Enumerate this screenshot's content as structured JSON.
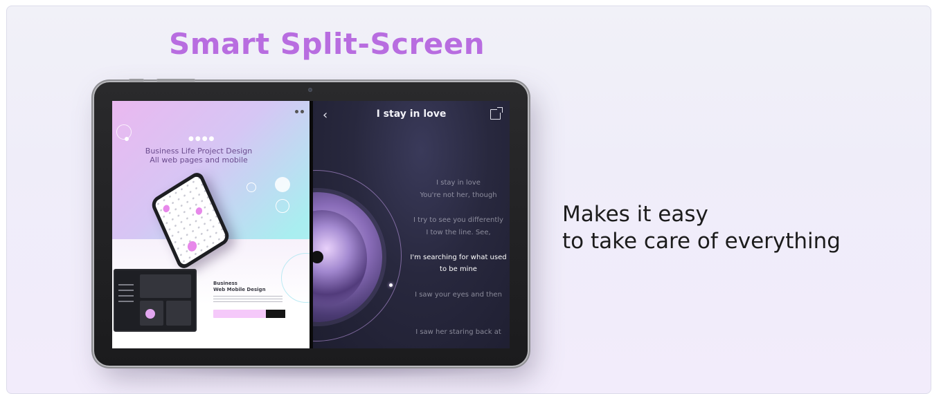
{
  "headline": "Smart Split-Screen",
  "tagline": {
    "line1": "Makes it easy",
    "line2": "to take care of everything"
  },
  "left_app": {
    "hero_title_line1": "Business Life Project Design",
    "hero_title_line2": "All web pages and mobile",
    "card_title_line1": "Business",
    "card_title_line2": "Web Mobile Design"
  },
  "music_app": {
    "song_title": "I stay in love",
    "back_icon": "chevron-left-icon",
    "share_icon": "external-share-icon",
    "lyrics": [
      {
        "text": "I stay in love",
        "active": false
      },
      {
        "text": "You're not her, though",
        "active": false
      },
      {
        "text": "I try to see you differently",
        "active": false
      },
      {
        "text": "I tow the line. See,",
        "active": false
      },
      {
        "text": "I'm searching for what used to be mine",
        "active": true
      },
      {
        "text": "I saw your eyes and then",
        "active": false
      },
      {
        "text": "I saw her staring back at",
        "active": false
      }
    ]
  },
  "colors": {
    "headline": "#b86de0",
    "tagline": "#1c1c1c",
    "background": "#f0eef9"
  }
}
